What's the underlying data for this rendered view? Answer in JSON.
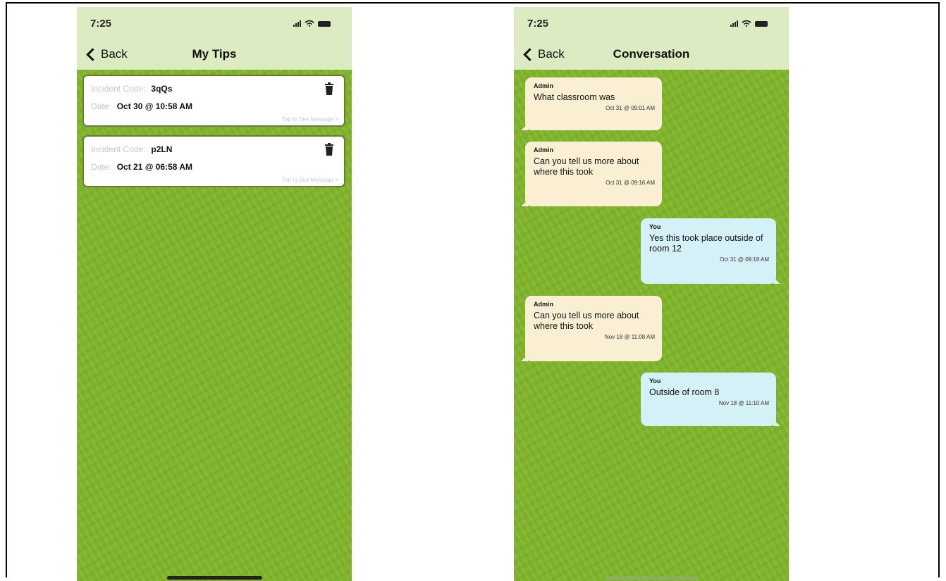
{
  "left_screen": {
    "status_time": "7:25",
    "nav": {
      "back_label": "Back",
      "title": "My Tips"
    },
    "tips": [
      {
        "code_label": "Incident Code:",
        "code": "3qQs",
        "date_label": "Date:",
        "date": "Oct 30 @ 10:58 AM",
        "hint": "Tap to See Message >"
      },
      {
        "code_label": "Incident Code:",
        "code": "p2LN",
        "date_label": "Date:",
        "date": "Oct 21 @ 06:58 AM",
        "hint": "Tap to See Message >"
      }
    ]
  },
  "right_screen": {
    "status_time": "7:25",
    "nav": {
      "back_label": "Back",
      "title": "Conversation"
    },
    "messages": [
      {
        "sender": "Admin",
        "text": "What classroom was",
        "timestamp": "Oct 31 @ 09:01 AM"
      },
      {
        "sender": "Admin",
        "text": "Can you tell us more about where this took",
        "timestamp": "Oct 31 @ 09:16 AM"
      },
      {
        "sender": "You",
        "text": "Yes this took place outside of room 12",
        "timestamp": "Oct 31 @ 09:18 AM"
      },
      {
        "sender": "Admin",
        "text": "Can you tell us more about where this took",
        "timestamp": "Nov 18 @ 11:08 AM"
      },
      {
        "sender": "You",
        "text": "Outside of room 8",
        "timestamp": "Nov 18 @ 11:10 AM"
      }
    ]
  },
  "colors": {
    "header_bg": "#dcebc2",
    "pattern_green": "#7fb42a",
    "admin_bubble": "#faefd3",
    "you_bubble": "#d3f1f7"
  },
  "icons": {
    "delete": "trash-icon",
    "back": "chevron-left-icon"
  }
}
